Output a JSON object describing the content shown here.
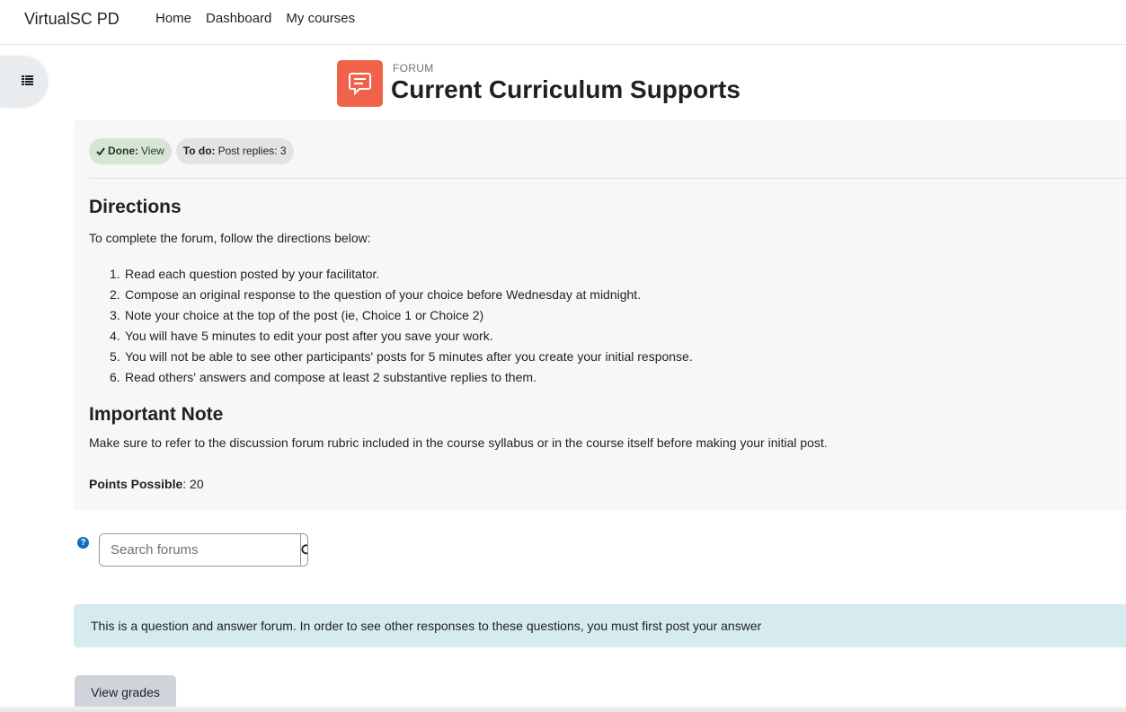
{
  "nav": {
    "brand": "VirtualSC PD",
    "links": [
      "Home",
      "Dashboard",
      "My courses"
    ]
  },
  "header": {
    "activity_type": "FORUM",
    "title": "Current Curriculum Supports",
    "icon": "forum-icon",
    "icon_color": "#f0624a"
  },
  "completion": {
    "done_label": "Done:",
    "done_value": "View",
    "todo_label": "To do:",
    "todo_value": "Post replies: 3"
  },
  "intro": {
    "directions_heading": "Directions",
    "directions_text": "To complete the forum, follow the directions below:",
    "steps": [
      "Read each question posted by your facilitator.",
      "Compose an original response to the question of your choice before Wednesday at midnight.",
      "Note your choice at the top of the post (ie, Choice 1 or Choice 2)",
      "You will have 5 minutes to edit your post after you save your work.",
      "You will not be able to see other participants' posts for 5 minutes after you create your initial response.",
      "Read others' answers and compose at least 2 substantive replies to them."
    ],
    "note_heading": "Important Note",
    "note_text": "Make sure to refer to the discussion forum rubric included in the course syllabus or in the course itself before making your initial post.",
    "points_label": "Points Possible",
    "points_value": ": 20"
  },
  "search": {
    "placeholder": "Search forums",
    "value": ""
  },
  "alert": {
    "text": "This is a question and answer forum. In order to see other responses to these questions, you must first post your answer",
    "color": "#d5ebf0"
  },
  "actions": {
    "view_grades": "View grades"
  }
}
